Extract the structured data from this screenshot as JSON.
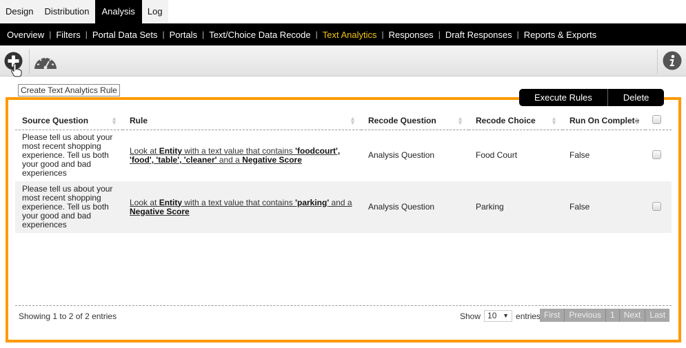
{
  "top_tabs": [
    {
      "label": "Design",
      "active": false
    },
    {
      "label": "Distribution",
      "active": false
    },
    {
      "label": "Analysis",
      "active": true
    },
    {
      "label": "Log",
      "active": false
    }
  ],
  "subnav": [
    {
      "label": "Overview"
    },
    {
      "label": "Filters"
    },
    {
      "label": "Portal Data Sets"
    },
    {
      "label": "Portals"
    },
    {
      "label": "Text/Choice Data Recode"
    },
    {
      "label": "Text Analytics",
      "active": true
    },
    {
      "label": "Responses"
    },
    {
      "label": "Draft Responses"
    },
    {
      "label": "Reports & Exports"
    }
  ],
  "toolbar": {
    "add_icon": "plus-circle-icon",
    "gauge_icon": "speedometer-icon",
    "info_icon": "info-icon",
    "tooltip": "Create Text Analytics Rule"
  },
  "actions": {
    "execute": "Execute Rules",
    "delete": "Delete"
  },
  "table": {
    "columns": [
      "Source Question",
      "Rule",
      "Recode Question",
      "Recode Choice",
      "Run On Complete"
    ],
    "rows": [
      {
        "source": "Please tell us about your most recent shopping experience. Tell us both your good and bad experiences",
        "rule": {
          "p1": "Look at ",
          "b1": "Entity",
          "p2": " with a text value that contains ",
          "b2": "'foodcourt', 'food', 'table', 'cleaner'",
          "p3": " and a ",
          "b3": "Negative Score"
        },
        "recode_question": "Analysis Question",
        "recode_choice": "Food Court",
        "run_on_complete": "False"
      },
      {
        "source": "Please tell us about your most recent shopping experience. Tell us both your good and bad experiences",
        "rule": {
          "p1": "Look at ",
          "b1": "Entity",
          "p2": " with a text value that contains ",
          "b2": "'parking'",
          "p3": " and a ",
          "b3": "Negative Score"
        },
        "recode_question": "Analysis Question",
        "recode_choice": "Parking",
        "run_on_complete": "False"
      }
    ]
  },
  "footer": {
    "info": "Showing 1 to 2 of 2 entries",
    "show_label": "Show",
    "page_size": "10",
    "entries_label": "entries",
    "pager": [
      "First",
      "Previous",
      "1",
      "Next",
      "Last"
    ]
  },
  "colors": {
    "accent_orange": "#ff9900",
    "active_nav": "#f5c518"
  }
}
